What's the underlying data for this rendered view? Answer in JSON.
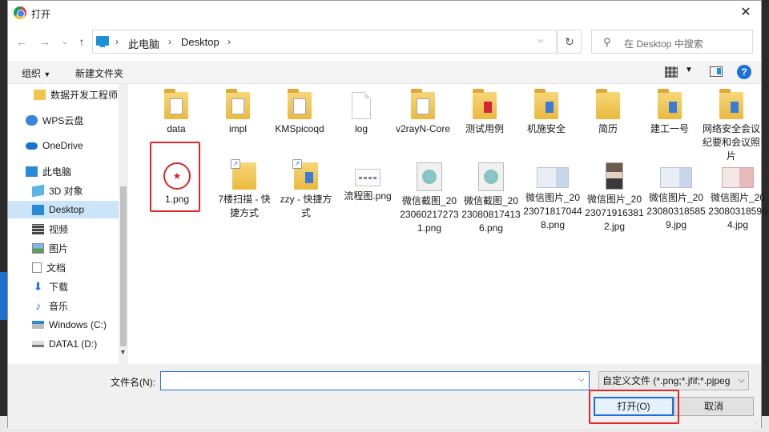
{
  "window": {
    "title": "打开"
  },
  "nav": {
    "back": "←",
    "forward": "→",
    "recent": "⌄",
    "up": "↑",
    "breadcrumb": [
      "此电脑",
      "Desktop"
    ],
    "separator": "›",
    "refresh": "↻",
    "search_placeholder": "在 Desktop 中搜索"
  },
  "toolbar": {
    "organize": "组织",
    "new_folder": "新建文件夹",
    "help": "?"
  },
  "sidebar": {
    "items": [
      {
        "label": "数据开发工程师",
        "icon": "folder-icon"
      },
      {
        "label": "WPS云盘",
        "icon": "cloud-icon"
      },
      {
        "label": "OneDrive",
        "icon": "onedrive-icon"
      },
      {
        "label": "此电脑",
        "icon": "computer-icon"
      },
      {
        "label": "3D 对象",
        "icon": "cube-icon"
      },
      {
        "label": "Desktop",
        "icon": "desktop-icon",
        "selected": true
      },
      {
        "label": "视频",
        "icon": "video-icon"
      },
      {
        "label": "图片",
        "icon": "picture-icon"
      },
      {
        "label": "文档",
        "icon": "document-icon"
      },
      {
        "label": "下载",
        "icon": "download-icon"
      },
      {
        "label": "音乐",
        "icon": "music-icon"
      },
      {
        "label": "Windows (C:)",
        "icon": "drive-icon"
      },
      {
        "label": "DATA1 (D:)",
        "icon": "drive-icon"
      }
    ]
  },
  "files": [
    {
      "name": "data",
      "kind": "folder"
    },
    {
      "name": "impl",
      "kind": "folder"
    },
    {
      "name": "KMSpicoqd",
      "kind": "folder"
    },
    {
      "name": "log",
      "kind": "blank"
    },
    {
      "name": "v2rayN-Core",
      "kind": "folder"
    },
    {
      "name": "测试用例",
      "kind": "folder-red"
    },
    {
      "name": "机施安全",
      "kind": "folder-blue"
    },
    {
      "name": "简历",
      "kind": "folder"
    },
    {
      "name": "建工一号",
      "kind": "folder-blue"
    },
    {
      "name": "网络安全会议纪要和会议照片",
      "kind": "folder-blue"
    },
    {
      "name": "1.png",
      "kind": "stamp",
      "stamp_glyph": "★"
    },
    {
      "name": "7楼扫描 - 快捷方式",
      "kind": "shortcut-folder"
    },
    {
      "name": "zzy - 快捷方式",
      "kind": "shortcut-folder"
    },
    {
      "name": "流程图.png",
      "kind": "flow"
    },
    {
      "name": "微信截图_20230602172731.png",
      "kind": "qr"
    },
    {
      "name": "微信截图_20230808174136.png",
      "kind": "qr"
    },
    {
      "name": "微信图片_20230718170448.png",
      "kind": "card"
    },
    {
      "name": "微信图片_20230719163812.jpg",
      "kind": "portrait"
    },
    {
      "name": "微信图片_20230803185859.jpg",
      "kind": "card"
    },
    {
      "name": "微信图片_20230803185904.jpg",
      "kind": "card-red"
    }
  ],
  "bottom": {
    "filename_label": "文件名(N):",
    "filename_value": "",
    "filetype": "自定义文件 (*.png;*.jfif;*.pjpeg",
    "open_label": "打开(O)",
    "cancel_label": "取消"
  },
  "colors": {
    "accent": "#1e6fd9",
    "highlight": "#e3262b",
    "selected_bg": "#cce4f7"
  }
}
